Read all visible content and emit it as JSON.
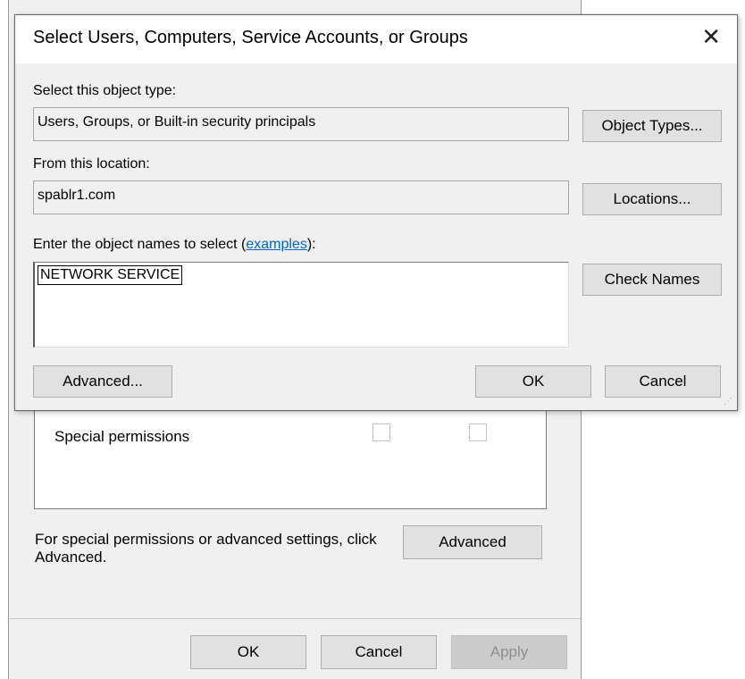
{
  "dialog": {
    "title": "Select Users, Computers, Service Accounts, or Groups",
    "object_type_label": "Select this object type:",
    "object_type_value": "Users, Groups, or Built-in security principals",
    "object_types_button": "Object Types...",
    "location_label": "From this location:",
    "location_value": "spablr1.com",
    "locations_button": "Locations...",
    "names_label_prefix": "Enter the object names to select (",
    "names_label_link": "examples",
    "names_label_suffix": "):",
    "names_value": "NETWORK SERVICE",
    "check_names_button": "Check Names",
    "advanced_button": "Advanced...",
    "ok_button": "OK",
    "cancel_button": "Cancel"
  },
  "background": {
    "permission_row": "Special permissions",
    "note": "For special permissions or advanced settings, click Advanced.",
    "advanced_button": "Advanced",
    "ok_button": "OK",
    "cancel_button": "Cancel",
    "apply_button": "Apply"
  }
}
